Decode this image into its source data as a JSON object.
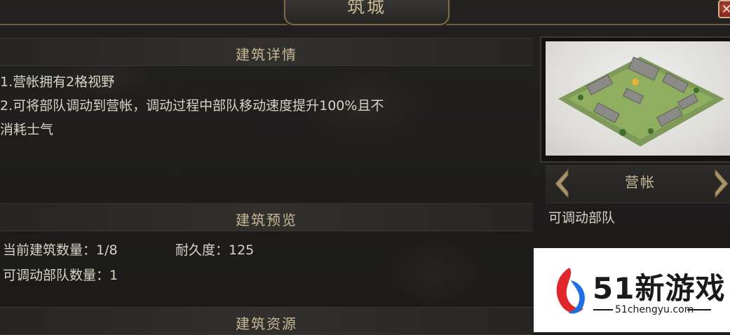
{
  "header": {
    "title": "筑城",
    "close_icon": "close-icon"
  },
  "details": {
    "heading": "建筑详情",
    "line1": "1.营帐拥有2格视野",
    "line2": "2.可将部队调动到营帐，调动过程中部队移动速度提升100%且不",
    "line3": "消耗士气"
  },
  "preview": {
    "heading": "建筑预览",
    "count_label": "当前建筑数量：1/8",
    "durability_label": "耐久度：125",
    "troops_label": "可调动部队数量：1"
  },
  "resources": {
    "heading": "建筑资源"
  },
  "side": {
    "building_name": "营帐",
    "caption": "可调动部队",
    "prev_icon": "chevron-left-icon",
    "next_icon": "chevron-right-icon"
  },
  "watermark": {
    "brand": "51新游戏",
    "url": "51chengyu.com"
  }
}
